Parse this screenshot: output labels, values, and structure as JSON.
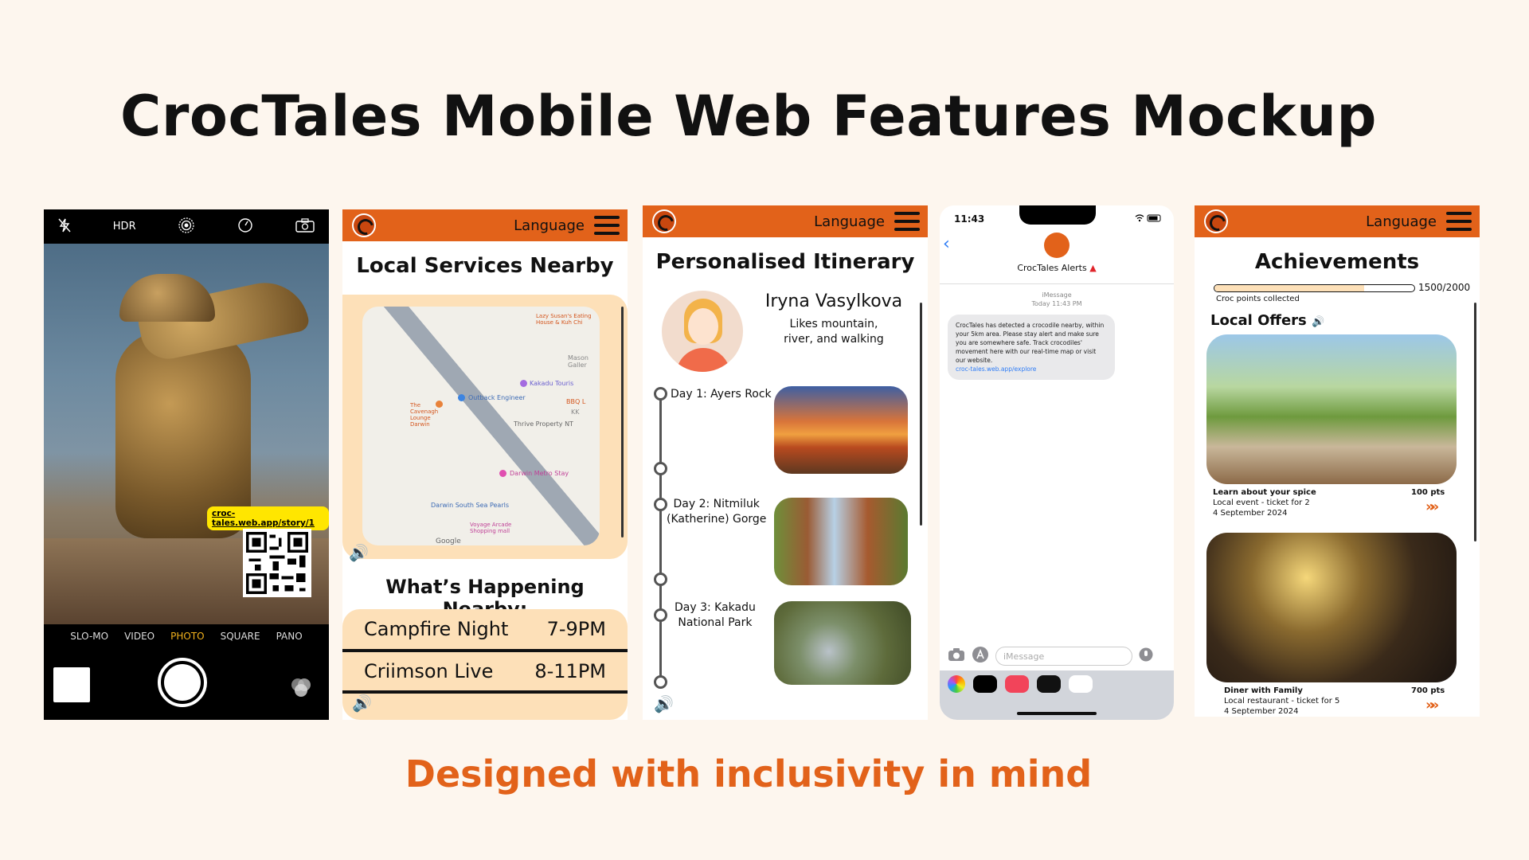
{
  "page": {
    "title": "CrocTales Mobile Web Features Mockup",
    "tagline": "Designed with inclusivity in mind"
  },
  "camera": {
    "top_icons": [
      "flash-off-icon",
      "HDR",
      "live-photo-icon",
      "timer-icon",
      "switch-camera-icon"
    ],
    "hdr_label": "HDR",
    "qr_url": "croc-tales.web.app/story/1",
    "modes": [
      "SLO-MO",
      "VIDEO",
      "PHOTO",
      "SQUARE",
      "PANO"
    ],
    "active_mode": "PHOTO"
  },
  "app_header": {
    "language_label": "Language"
  },
  "local_services": {
    "title": "Local Services Nearby",
    "map_labels": [
      "Lazy Susan's Eating House & Kuh Chi",
      "Mason Galler",
      "Kakadu Touris",
      "Outback Engineer",
      "BBQ L",
      "KK",
      "Thrive Property NT",
      "The Cavenagh Lounge Darwin",
      "Darwin Metro Stay",
      "Darwin South Sea Pearls",
      "Voyage Arcade Shopping mall",
      "Google"
    ],
    "happening_title": "What’s Happening Nearby:",
    "events": [
      {
        "name": "Campfire Night",
        "time": "7-9PM"
      },
      {
        "name": "Criimson Live",
        "time": "8-11PM"
      }
    ]
  },
  "itinerary": {
    "title": "Personalised Itinerary",
    "person_name": "Iryna Vasylkova",
    "person_desc_line1": "Likes mountain,",
    "person_desc_line2": "river, and walking",
    "days": [
      {
        "label_line1": "Day 1: Ayers Rock",
        "label_line2": ""
      },
      {
        "label_line1": "Day 2: Nitmiluk",
        "label_line2": "(Katherine) Gorge"
      },
      {
        "label_line1": "Day 3: Kakadu",
        "label_line2": "National Park"
      }
    ]
  },
  "messages": {
    "time": "11:43",
    "sender": "CrocTales Alerts",
    "service": "iMessage",
    "timestamp": "Today 11:43 PM",
    "body": "CrocTales has detected a crocodile nearby, within your 5km area. Please stay alert and make sure you are somewhere safe. Track crocodiles' movement here with our real-time map or visit our website.",
    "link": "croc-tales.web.app/explore",
    "input_placeholder": "iMessage",
    "apps": [
      "photos-app-icon",
      "apple-pay-icon",
      "search-images-icon",
      "digital-touch-icon",
      "more-icon"
    ],
    "colors": {
      "link": "#2f7df6",
      "alert": "#e0242a"
    }
  },
  "achievements": {
    "title": "Achievements",
    "points_value": "1500/2000",
    "points_progress": 0.75,
    "points_label": "Croc points collected",
    "offers_title": "Local Offers",
    "offers": [
      {
        "title": "Learn about your spice",
        "sub1": "Local event - ticket for 2",
        "sub2": "4 September 2024",
        "points": "100 pts"
      },
      {
        "title": "Diner with Family",
        "sub1": "Local restaurant - ticket for 5",
        "sub2": "4 September 2024",
        "points": "700 pts"
      }
    ]
  },
  "colors": {
    "accent": "#e2621a",
    "cream": "#fde0b8",
    "background": "#fdf6ee"
  }
}
